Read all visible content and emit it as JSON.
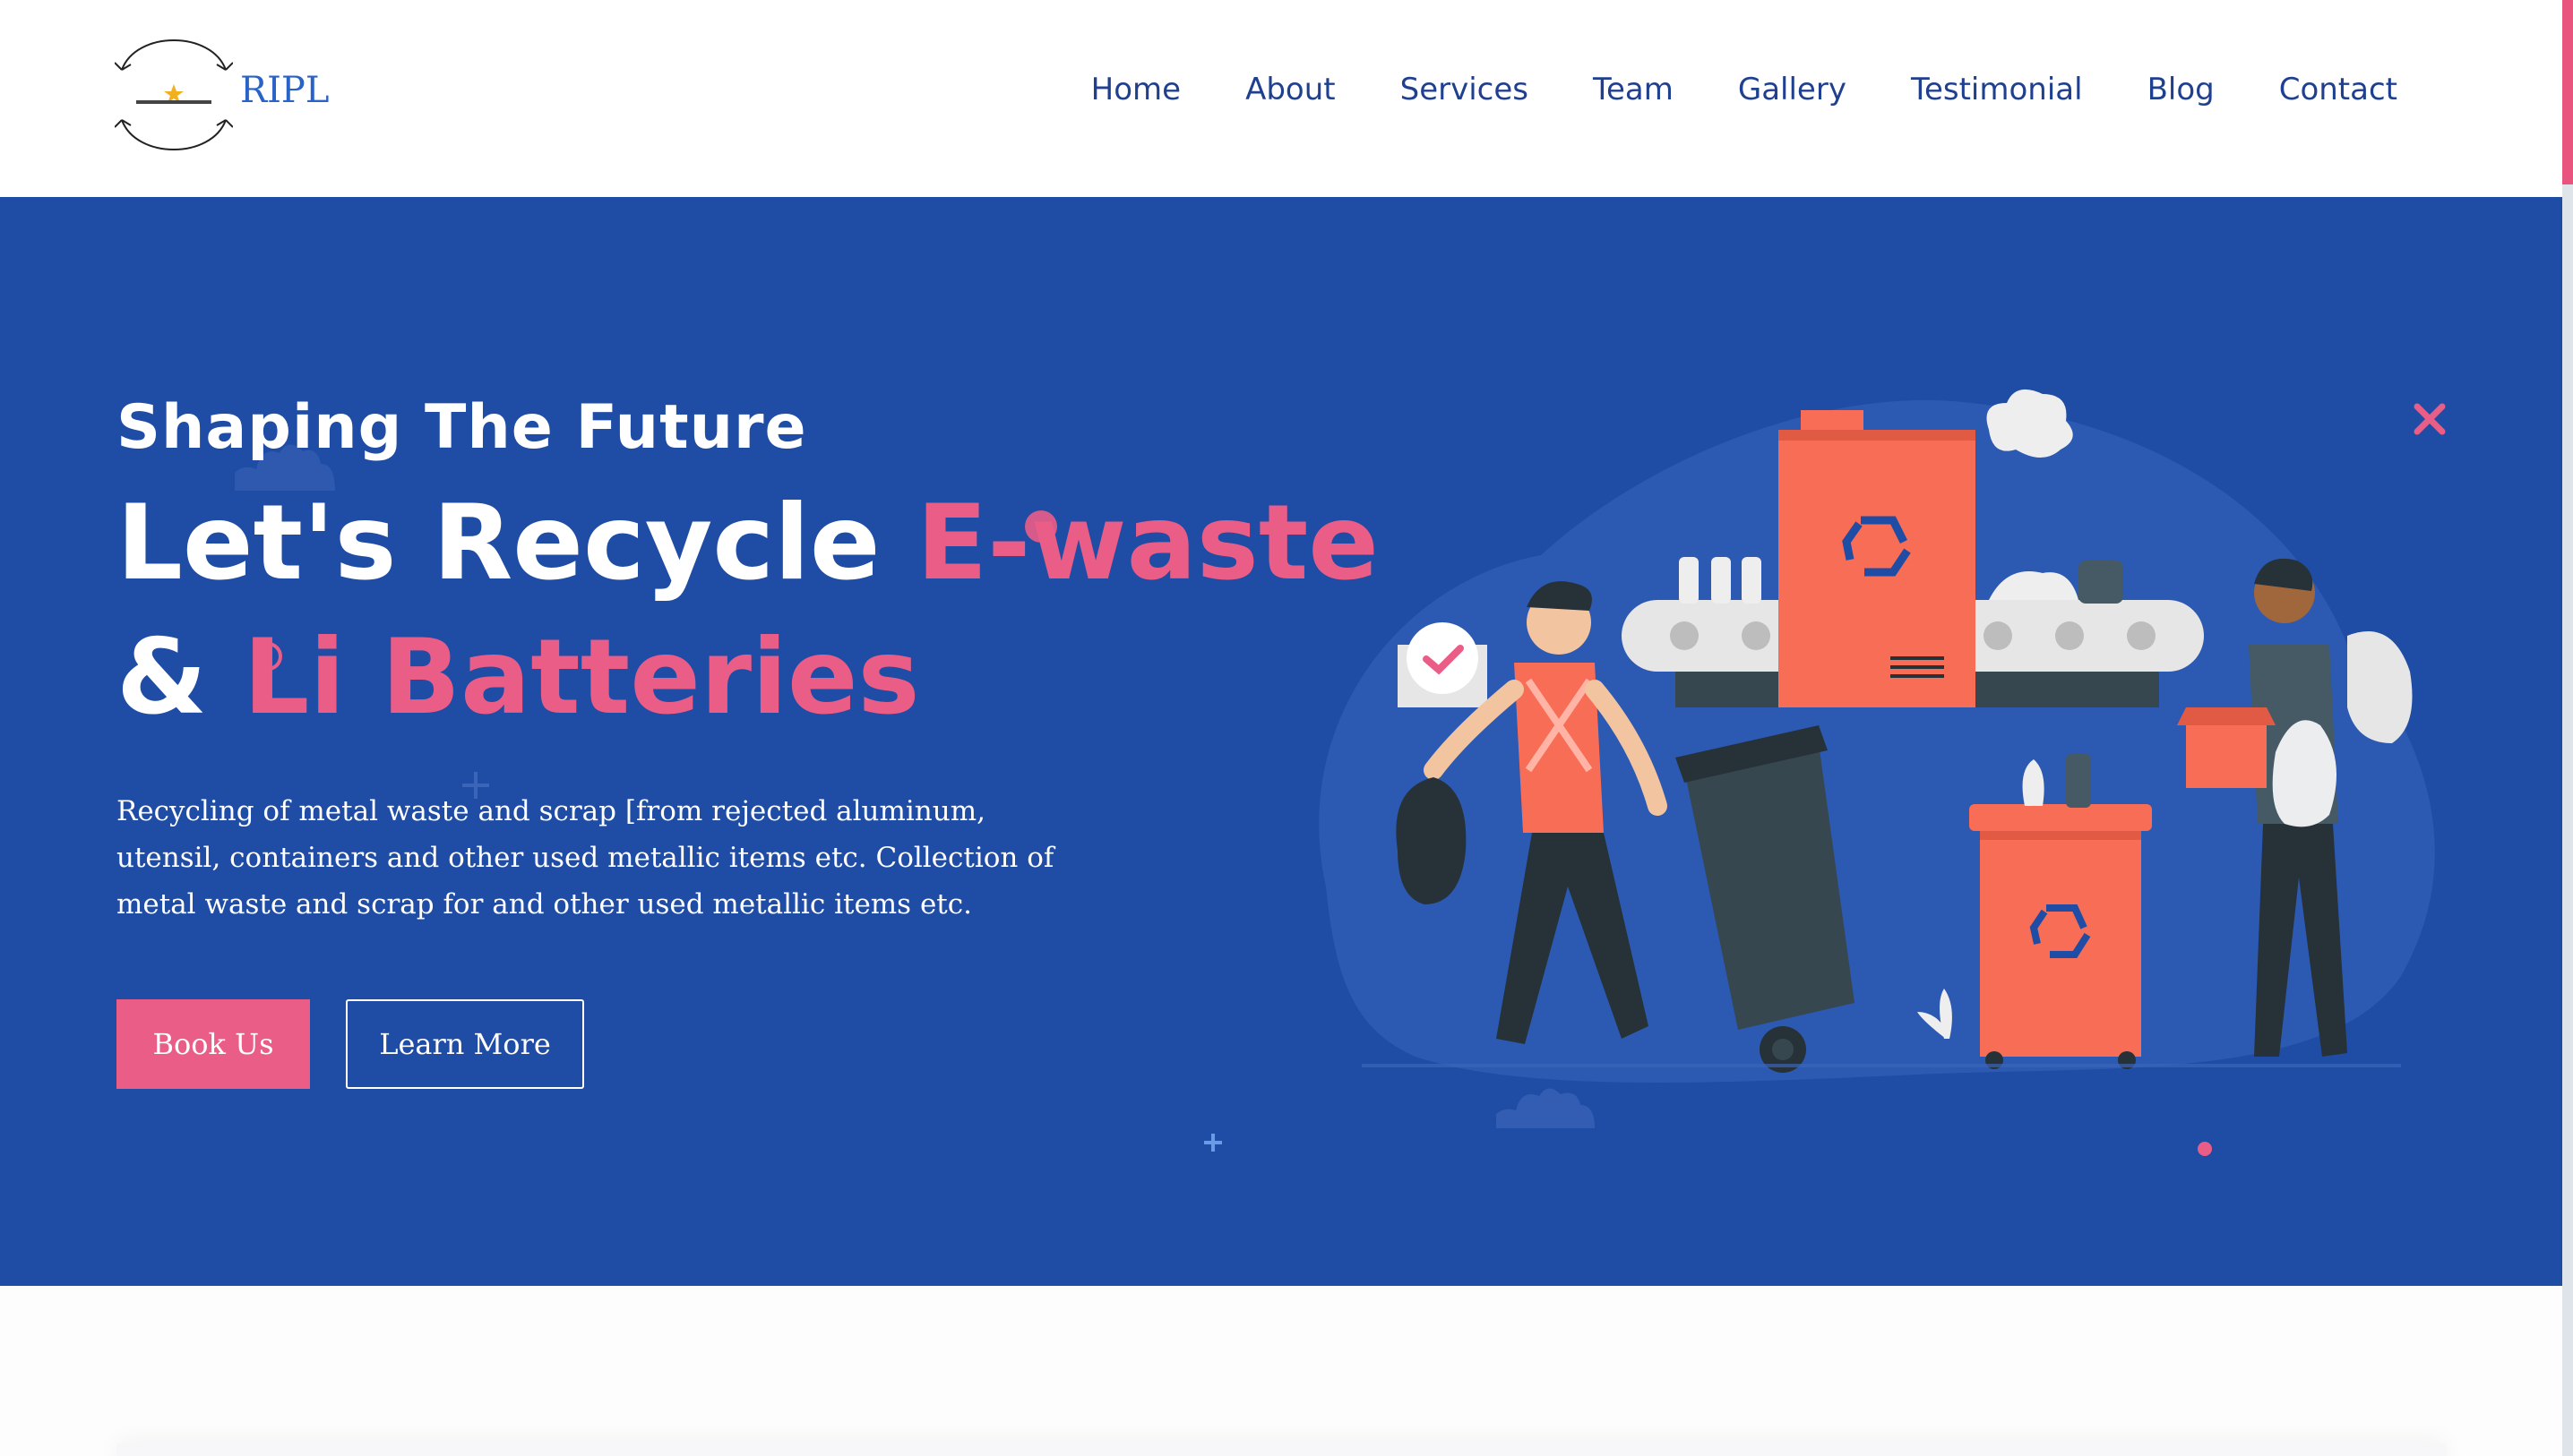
{
  "brand": {
    "name": "RIPL"
  },
  "nav": {
    "items": [
      "Home",
      "About",
      "Services",
      "Team",
      "Gallery",
      "Testimonial",
      "Blog",
      "Contact"
    ]
  },
  "hero": {
    "eyebrow": "Shaping The Future",
    "headline_part1": "Let's Recycle ",
    "headline_highlight1": "E-waste",
    "headline_amp": "& ",
    "headline_highlight2": "Li Batteries",
    "description": "Recycling of metal waste and scrap [from rejected aluminum, utensil, containers and other used metallic items etc. Collection of metal waste and scrap for and other used metallic items etc.",
    "book_label": "Book Us",
    "learn_label": "Learn More"
  },
  "colors": {
    "primary": "#1f4ca5",
    "accent": "#ea5d87",
    "nav_text": "#1f3f8f",
    "brand_text": "#2a63c8",
    "illustration_orange": "#f86d55",
    "illustration_dark": "#263238"
  },
  "icons": [
    "logo-emblem-icon",
    "recycle-icon",
    "checkmark-icon",
    "cross-sparkle-icon"
  ]
}
